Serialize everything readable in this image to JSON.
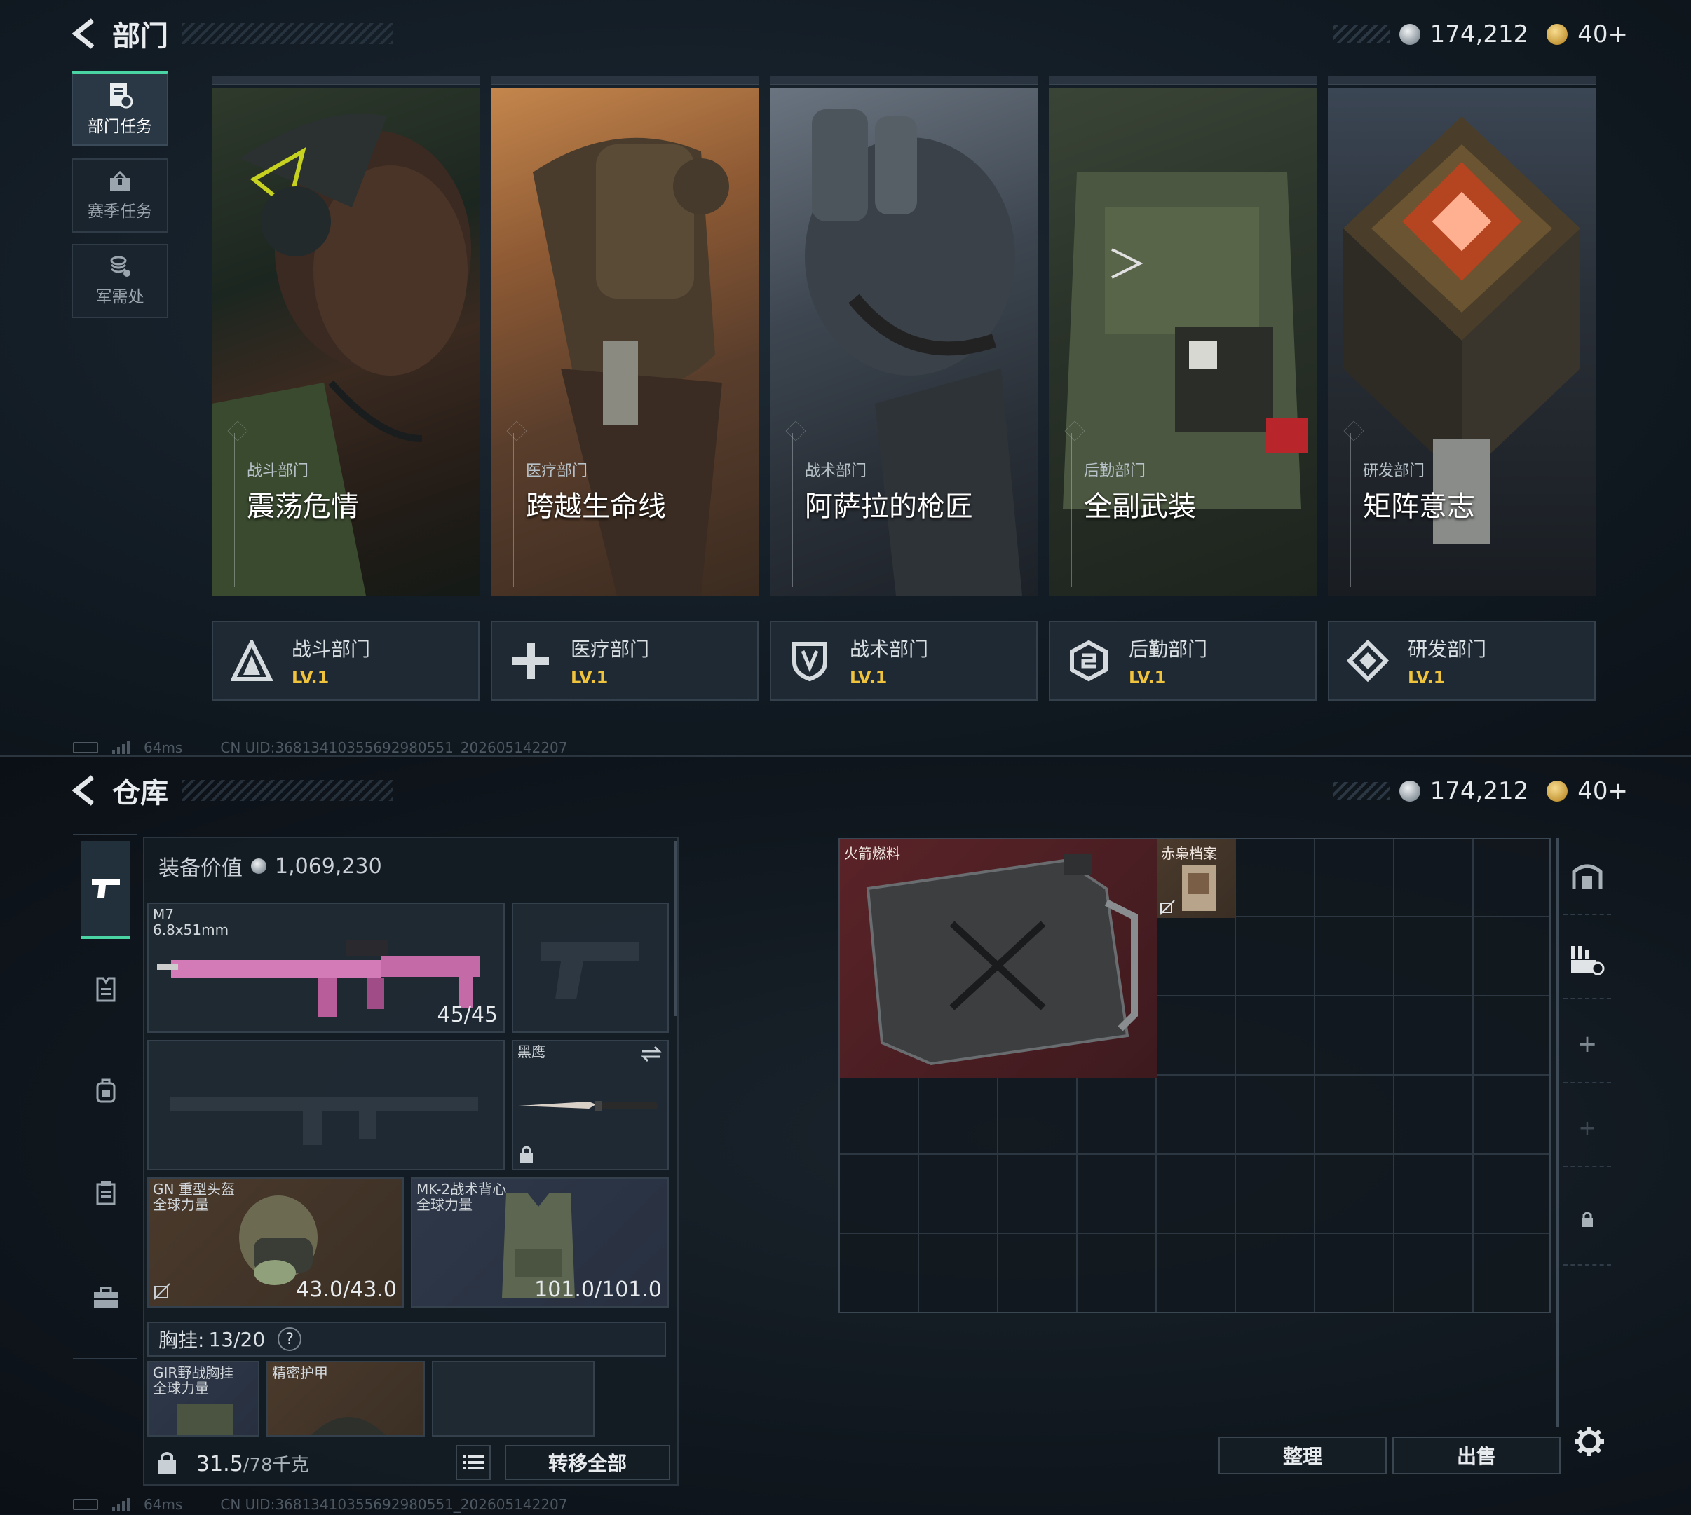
{
  "top": {
    "header": {
      "title": "部门"
    },
    "currency": {
      "silver": "174,212",
      "gold": "40+"
    },
    "sidebar": {
      "items": [
        {
          "label": "部门任务",
          "icon": "mission-document-icon",
          "active": true
        },
        {
          "label": "赛季任务",
          "icon": "season-box-icon",
          "active": false
        },
        {
          "label": "军需处",
          "icon": "coins-stack-icon",
          "active": false
        }
      ]
    },
    "cards": [
      {
        "dept": "战斗部门",
        "name": "震荡危情"
      },
      {
        "dept": "医疗部门",
        "name": "跨越生命线"
      },
      {
        "dept": "战术部门",
        "name": "阿萨拉的枪匠"
      },
      {
        "dept": "后勤部门",
        "name": "全副武装"
      },
      {
        "dept": "研发部门",
        "name": "矩阵意志"
      }
    ],
    "tiles": [
      {
        "label": "战斗部门",
        "level": "LV.1",
        "icon": "combat-triangle-icon"
      },
      {
        "label": "医疗部门",
        "level": "LV.1",
        "icon": "medical-cross-icon"
      },
      {
        "label": "战术部门",
        "level": "LV.1",
        "icon": "tactical-shield-icon"
      },
      {
        "label": "后勤部门",
        "level": "LV.1",
        "icon": "logistics-hex-icon"
      },
      {
        "label": "研发部门",
        "level": "LV.1",
        "icon": "research-diamond-icon"
      }
    ],
    "status": {
      "ping": "64ms",
      "uid": "CN UID:36813410355692980551_202605142207"
    }
  },
  "bottom": {
    "header": {
      "title": "仓库"
    },
    "currency": {
      "silver": "174,212",
      "gold": "40+"
    },
    "equip_value": {
      "label": "装备价值",
      "value": "1,069,230"
    },
    "slots": {
      "primary": {
        "name": "M7",
        "caliber": "6.8x51mm",
        "ammo": "45/45"
      },
      "knife": {
        "name": "黑鹰"
      },
      "helmet": {
        "name": "GN 重型头盔",
        "sub": "全球力量",
        "durability": "43.0/43.0"
      },
      "armor": {
        "name": "MK-2战术背心",
        "sub": "全球力量",
        "durability": "101.0/101.0"
      }
    },
    "chest": {
      "label": "胸挂:",
      "value": "13/20",
      "help": "?"
    },
    "chest_items": [
      {
        "name": "GIR野战胸挂",
        "sub": "全球力量"
      },
      {
        "name": "精密护甲",
        "sub": ""
      }
    ],
    "footer": {
      "weight": "31.5",
      "capacity": "/78千克",
      "transfer_label": "转移全部"
    },
    "storage": {
      "items": [
        {
          "name": "火箭燃料"
        },
        {
          "name": "赤枭档案"
        }
      ]
    },
    "buttons": {
      "sort": "整理",
      "sell": "出售"
    },
    "status": {
      "ping": "64ms",
      "uid": "CN UID:36813410355692980551_202605142207"
    }
  },
  "colors": {
    "accent": "#4bd4a3",
    "level": "#f0c33c"
  }
}
